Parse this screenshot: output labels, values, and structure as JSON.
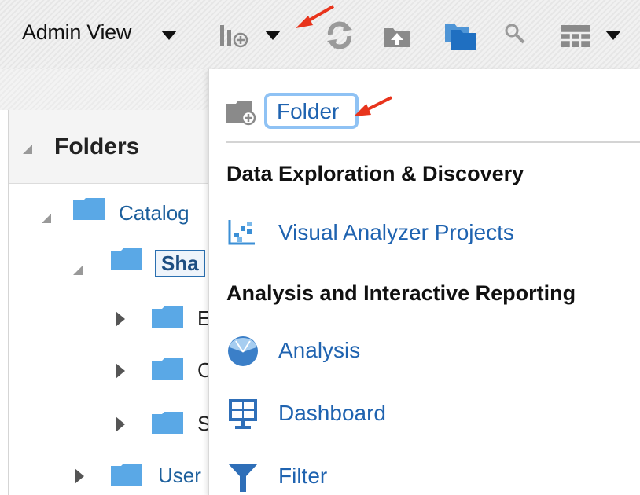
{
  "toolbar": {
    "view_label": "Admin View",
    "icons": [
      "new-chart-icon",
      "refresh-icon",
      "upload-icon",
      "copy-folder-icon",
      "search-icon",
      "grid-icon"
    ]
  },
  "folders_panel": {
    "title": "Folders",
    "items": [
      {
        "label": "Catalog",
        "expanded": true
      },
      {
        "label": "Sha",
        "expanded": true,
        "selected": true
      },
      {
        "label": "E",
        "expanded": false
      },
      {
        "label": "C",
        "expanded": false
      },
      {
        "label": "S",
        "expanded": false
      },
      {
        "label": "User",
        "expanded": false
      }
    ]
  },
  "new_menu": {
    "folder_label": "Folder",
    "sections": [
      {
        "title": "Data Exploration & Discovery",
        "items": [
          {
            "label": "Visual Analyzer Projects",
            "icon": "scatter-icon"
          }
        ]
      },
      {
        "title": "Analysis and Interactive Reporting",
        "items": [
          {
            "label": "Analysis",
            "icon": "analysis-icon"
          },
          {
            "label": "Dashboard",
            "icon": "dashboard-icon"
          },
          {
            "label": "Filter",
            "icon": "filter-icon"
          }
        ]
      }
    ]
  },
  "colors": {
    "link_blue": "#1f63b0",
    "folder_blue": "#5aa8e6",
    "annotation_red": "#e8341c",
    "focus_ring": "#8fc2f4"
  }
}
